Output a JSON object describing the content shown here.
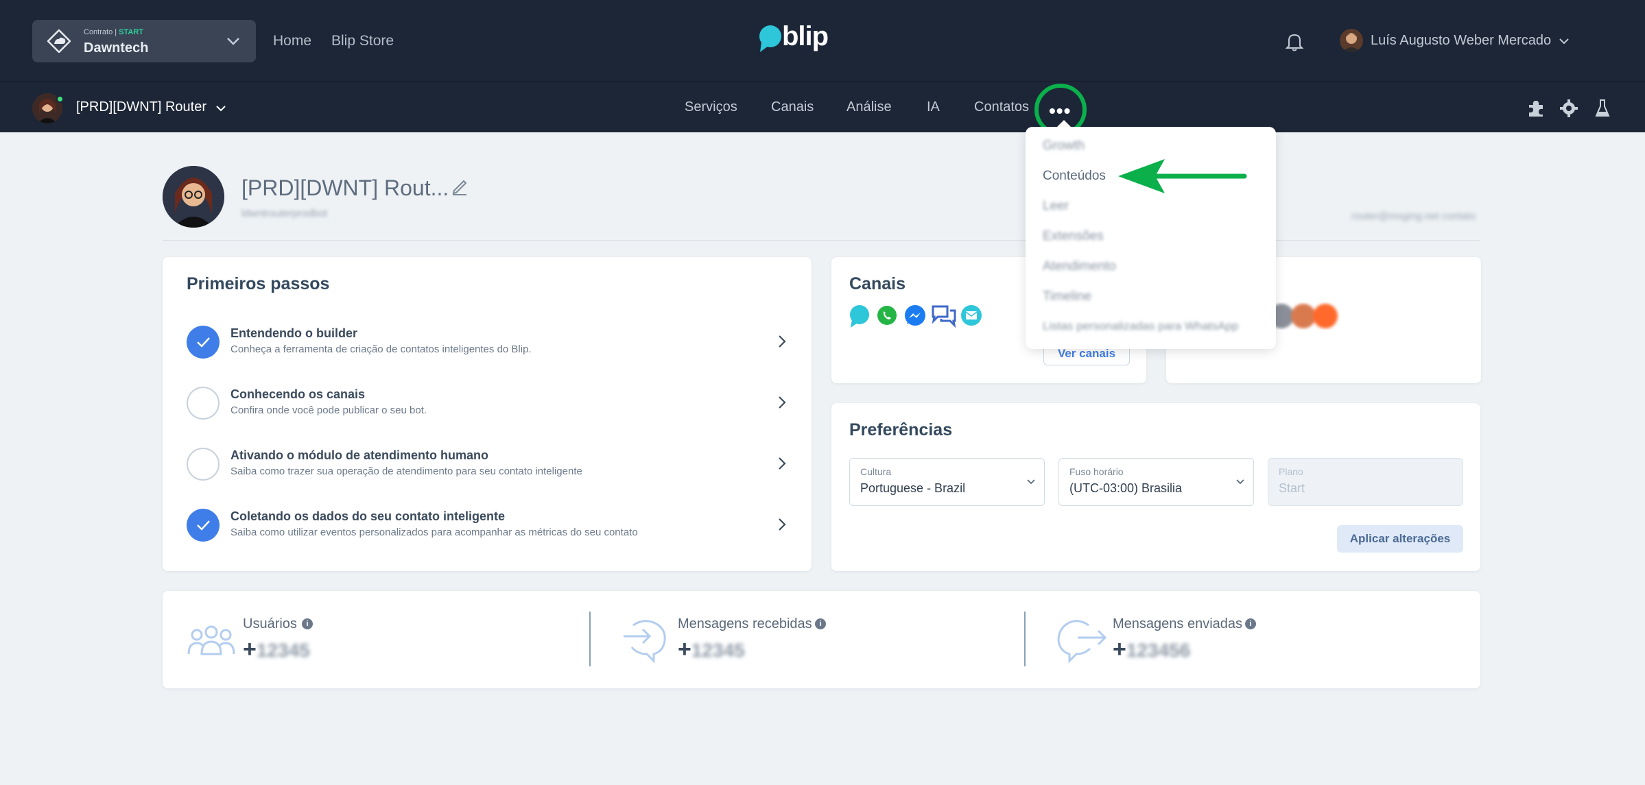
{
  "topbar": {
    "contract_label": "Contrato |",
    "contract_plan": "START",
    "contract_name": "Dawntech",
    "nav": [
      "Home",
      "Blip Store"
    ],
    "brand": "blip",
    "user_name": "Luís Augusto Weber Mercado"
  },
  "subbar": {
    "bot_name": "[PRD][DWNT] Router",
    "nav": [
      "Serviços",
      "Canais",
      "Análise",
      "IA",
      "Contatos"
    ],
    "more_label": "•••"
  },
  "dropdown": {
    "items": [
      "Growth",
      "Conteúdos",
      "Leer",
      "Extensões",
      "Atendimento",
      "Timeline",
      "Listas personalizadas para WhatsApp"
    ]
  },
  "profile": {
    "name": "[PRD][DWNT] Rout...",
    "identifier": "ldwntrouterprodbot",
    "right_info": "router@msging.net contato"
  },
  "first_steps": {
    "title": "Primeiros passos",
    "steps": [
      {
        "title": "Entendendo o builder",
        "subtitle": "Conheça a ferramenta de criação de contatos inteligentes do Blip.",
        "done": true
      },
      {
        "title": "Conhecendo os canais",
        "subtitle": "Confira onde você pode publicar o seu bot.",
        "done": false
      },
      {
        "title": "Ativando o módulo de atendimento humano",
        "subtitle": "Saiba como trazer sua operação de atendimento para seu contato inteligente",
        "done": false
      },
      {
        "title": "Coletando os dados do seu contato inteligente",
        "subtitle": "Saiba como utilizar eventos personalizados para acompanhar as métricas do seu contato",
        "done": true
      }
    ]
  },
  "channels": {
    "title": "Canais",
    "icons": [
      "blip-chat-icon",
      "whatsapp-icon",
      "messenger-icon",
      "chat-bubbles-icon",
      "email-icon"
    ],
    "button": "Ver canais"
  },
  "preferences": {
    "title": "Preferências",
    "fields": [
      {
        "label": "Cultura",
        "value": "Portuguese - Brazil"
      },
      {
        "label": "Fuso horário",
        "value": "(UTC-03:00) Brasilia"
      },
      {
        "label": "Plano",
        "value": "Start"
      }
    ],
    "apply": "Aplicar alterações"
  },
  "stats": [
    {
      "label": "Usuários",
      "value": "+",
      "hidden": "12345"
    },
    {
      "label": "Mensagens recebidas",
      "value": "+",
      "hidden": "12345"
    },
    {
      "label": "Mensagens enviadas",
      "value": "+",
      "hidden": "123456"
    }
  ],
  "colors": {
    "topbar": "#1c2637",
    "accent": "#3f7de8",
    "highlight": "#0bb04b",
    "background": "#eef2f5"
  }
}
